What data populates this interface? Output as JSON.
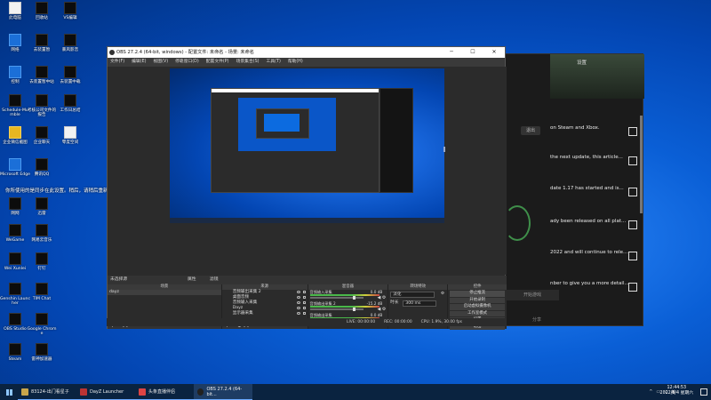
{
  "desktop": {
    "icons": [
      {
        "label": "此电脑"
      },
      {
        "label": "回收站"
      },
      {
        "label": "VS编辑"
      },
      {
        "label": "网络"
      },
      {
        "label": "去装置暂"
      },
      {
        "label": "暴风影音"
      },
      {
        "label": "控制"
      },
      {
        "label": "去装置暂中站"
      },
      {
        "label": "去装置中载"
      },
      {
        "label": "Schedule-Mumble"
      },
      {
        "label": "考核公司文件的报告"
      },
      {
        "label": "工作日总结"
      },
      {
        "label": "企业微信截图"
      },
      {
        "label": "企业聊天"
      },
      {
        "label": "零度空间"
      },
      {
        "label": "Microsoft Edge"
      },
      {
        "label": "腾讯QQ"
      },
      {
        "label": "网网"
      },
      {
        "label": "迅雷"
      },
      {
        "label": "WeGame"
      },
      {
        "label": "网易云音乐"
      },
      {
        "label": "Wei Xunlei"
      },
      {
        "label": "钉钉"
      },
      {
        "label": "Genshin Launcher"
      },
      {
        "label": "TIM Chat"
      },
      {
        "label": "OBS Studio"
      },
      {
        "label": "Google Chrome"
      },
      {
        "label": "Steam"
      },
      {
        "label": "雷神加速器"
      }
    ],
    "note": "你所使用的是同步在此设置。稍后，请稍后重新加载的游戏任务栏"
  },
  "bg_app": {
    "settings": "设置",
    "exit": "退出",
    "news": [
      "on Steam and Xbox.",
      "the next update, this article...",
      "date 1.17 has started and is...",
      "ady been released on all plat...",
      "2022 and will continue to rele...",
      "nber to give you a more detail..."
    ],
    "bottom_btn": "开始游戏",
    "side_label": "分享"
  },
  "obs": {
    "title": "OBS 27.2.4 (64-bit, windows) - 配置文件: 未命名 - 场景: 未命名",
    "menu": [
      "文件(F)",
      "编辑(E)",
      "视图(V)",
      "停靠窗口(D)",
      "配置文件(P)",
      "场景集合(S)",
      "工具(T)",
      "帮助(H)"
    ],
    "scene_bar": {
      "title": "未选择源",
      "props": "属性",
      "filters": "滤镜"
    },
    "docks": {
      "scenes": {
        "title": "场景",
        "items": [
          "dayz"
        ]
      },
      "sources": {
        "title": "来源",
        "items": [
          "音频输出采集 2",
          "桌面音频",
          "音频输入采集",
          "Dayz",
          "显示器采集"
        ]
      },
      "mixer": {
        "title": "混音器",
        "rows": [
          {
            "name": "音频输入采集",
            "db": "0.0 dB"
          },
          {
            "name": "音频输出采集 2",
            "db": "-15.2 dB"
          },
          {
            "name": "音频输出采集",
            "db": "0.0 dB"
          }
        ]
      },
      "transitions": {
        "title": "转场特效",
        "type": "淡化",
        "duration_label": "时长",
        "duration": "300 ms"
      },
      "controls": {
        "title": "控件",
        "buttons": [
          "停止推流",
          "开始录制",
          "启动虚拟摄像机",
          "工作室模式",
          "设置",
          "退出"
        ]
      }
    },
    "status": {
      "live": "LIVE: 00:00:00",
      "rec": "REC: 00:00:00",
      "cpu": "CPU: 1.9%, 30.00 fps"
    }
  },
  "taskbar": {
    "items": [
      {
        "label": "83124-出门看星子"
      },
      {
        "label": "DayZ Launcher"
      },
      {
        "label": "头条直播伴侣"
      },
      {
        "label": "OBS 27.2.4 (64-bit..."
      }
    ],
    "clock_time": "12:44:53",
    "clock_date": "2022/6/4 星期六",
    "ime": "英"
  }
}
